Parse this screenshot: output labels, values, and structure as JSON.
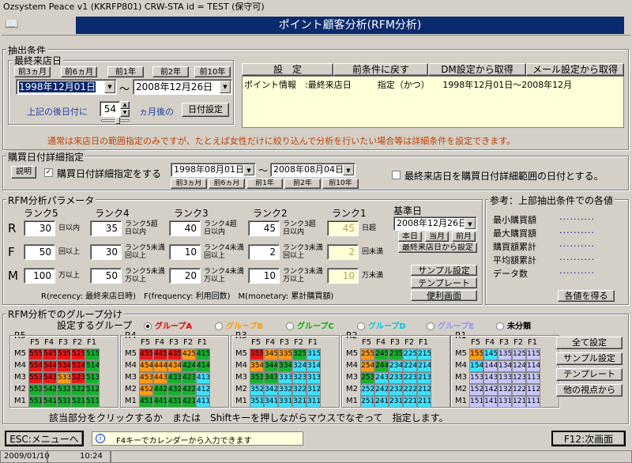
{
  "window_title": "Ozsystem Peace v1 (KKRFP801)   CRW-STA   id = TEST   (保守可)",
  "banner_title": "ポイント顧客分析(RFM分析)",
  "extract": {
    "group_label": "抽出条件",
    "last_visit_label": "最終来店日",
    "range_buttons": [
      "前3ヵ月",
      "前6ヵ月",
      "前1年",
      "前2年",
      "前10年"
    ],
    "date_from": "1998年12月01日",
    "date_to": "2008年12月26日",
    "tilde": "～",
    "after_label": "上記の後日付に",
    "months_value": "54",
    "months_suffix": "ヵ月後の",
    "set_date_button": "日付設定",
    "tabs": [
      "設　定",
      "前条件に戻す",
      "DM設定から取得",
      "メール設定から取得"
    ],
    "condition_text": "ポイント情報　:最終来店日　　　指定（かつ）　　1998年12月01日～2008年12月",
    "note": "通常は来店日の範囲指定のみですが、たとえば女性だけに絞り込んで分析を行いたい場合等は詳細条件を設定できます。"
  },
  "purchase": {
    "group_label": "購買日付詳細指定",
    "explain_button": "説明",
    "checkbox_label": "購買日付詳細指定をする",
    "checkbox_checked": "✓",
    "date_from": "1998年08月01日",
    "date_to": "2008年08月04日",
    "tilde": "～",
    "range_buttons": [
      "前3ヵ月",
      "前6ヵ月",
      "前1年",
      "前2年",
      "前10年"
    ],
    "last_visit_checkbox_label": "最終来店日を購買日付詳細範囲の日付とする。"
  },
  "rfm": {
    "group_label": "RFM分析パラメータ",
    "rank_headers": [
      "ランク5",
      "ランク4",
      "ランク3",
      "ランク2",
      "ランク1"
    ],
    "row_letters": [
      "R",
      "F",
      "M"
    ],
    "r_values": [
      "30",
      "35",
      "40",
      "45",
      "45"
    ],
    "f_values": [
      "50",
      "30",
      "10",
      "2",
      "2"
    ],
    "m_values": [
      "100",
      "50",
      "20",
      "10",
      "10"
    ],
    "r_units": [
      "日以内",
      "ランク5超\n日以内",
      "ランク4超\n日以内",
      "ランク3超\n日以内",
      "日超"
    ],
    "f_units": [
      "回以上",
      "ランク5未満\n回以上",
      "ランク4未満\n回以上",
      "ランク3未満\n回以上",
      "回未満"
    ],
    "m_units": [
      "万以上",
      "ランク5未満\n万以上",
      "ランク4未満\n万以上",
      "ランク3未満\n万以上",
      "万未満"
    ],
    "base_date_label": "基準日",
    "base_date": "2008年12月26日",
    "base_buttons": [
      "本日",
      "当月",
      "前月"
    ],
    "from_last_visit_button": "最終来店日から設定",
    "sample_button": "サンプル設定",
    "template_button": "テンプレート",
    "convenient_button": "便利画面",
    "legend": "R(recency: 最終来店日時)　F(frequency: 利用回数)　M(monetary: 累計購買額)"
  },
  "reference": {
    "group_label": "参考：上部抽出条件での各値",
    "items": [
      "最小購買額",
      "最大購買額",
      "購買額累計",
      "平均額累計",
      "データ数"
    ],
    "dots": "..........",
    "get_button": "各値を得る"
  },
  "groups": {
    "group_label": "RFM分析でのグループ分け",
    "set_label": "設定するグループ",
    "options": [
      {
        "label": "グループA",
        "color": "#e00000",
        "on": true
      },
      {
        "label": "グループB",
        "color": "#ff9900",
        "on": false
      },
      {
        "label": "グループC",
        "color": "#00b000",
        "on": false
      },
      {
        "label": "グループD",
        "color": "#00c8e0",
        "on": false
      },
      {
        "label": "グループE",
        "color": "#9090ff",
        "on": false
      },
      {
        "label": "未分類",
        "color": "#000000",
        "on": false
      }
    ],
    "f_headers": [
      "F5",
      "F4",
      "F3",
      "F2",
      "F1"
    ],
    "m_labels": [
      "M5",
      "M4",
      "M3",
      "M2",
      "M1"
    ],
    "blocks": [
      {
        "title": "R5",
        "rows": [
          [
            "555",
            "545",
            "535",
            "525",
            "515"
          ],
          [
            "554",
            "544",
            "534",
            "524",
            "514"
          ],
          [
            "553",
            "543",
            "533",
            "523",
            "513"
          ],
          [
            "552",
            "542",
            "532",
            "522",
            "512"
          ],
          [
            "551",
            "541",
            "531",
            "521",
            "511"
          ]
        ],
        "colors": [
          [
            "r",
            "r",
            "r",
            "r",
            "g"
          ],
          [
            "r",
            "r",
            "r",
            "r",
            "g"
          ],
          [
            "r",
            "r",
            "o",
            "r",
            "g"
          ],
          [
            "g",
            "g",
            "g",
            "g",
            "g"
          ],
          [
            "g",
            "g",
            "g",
            "g",
            "g"
          ]
        ]
      },
      {
        "title": "R4",
        "rows": [
          [
            "455",
            "445",
            "435",
            "425",
            "415"
          ],
          [
            "454",
            "444",
            "434",
            "424",
            "414"
          ],
          [
            "453",
            "443",
            "433",
            "423",
            "413"
          ],
          [
            "452",
            "442",
            "432",
            "422",
            "412"
          ],
          [
            "451",
            "441",
            "431",
            "421",
            "411"
          ]
        ],
        "colors": [
          [
            "r",
            "r",
            "r",
            "o",
            "g"
          ],
          [
            "o",
            "o",
            "o",
            "g",
            "g"
          ],
          [
            "o",
            "o",
            "g",
            "g",
            "c"
          ],
          [
            "o",
            "g",
            "g",
            "g",
            "c"
          ],
          [
            "g",
            "g",
            "g",
            "g",
            "c"
          ]
        ]
      },
      {
        "title": "R3",
        "rows": [
          [
            "355",
            "345",
            "335",
            "325",
            "315"
          ],
          [
            "354",
            "344",
            "334",
            "324",
            "314"
          ],
          [
            "353",
            "343",
            "333",
            "323",
            "313"
          ],
          [
            "352",
            "342",
            "332",
            "322",
            "312"
          ],
          [
            "351",
            "341",
            "331",
            "321",
            "311"
          ]
        ],
        "colors": [
          [
            "r",
            "o",
            "o",
            "g",
            "c"
          ],
          [
            "o",
            "g",
            "g",
            "c",
            "c"
          ],
          [
            "g",
            "g",
            "c",
            "c",
            "c"
          ],
          [
            "c",
            "c",
            "c",
            "c",
            "c"
          ],
          [
            "c",
            "c",
            "c",
            "c",
            "c"
          ]
        ]
      },
      {
        "title": "R2",
        "rows": [
          [
            "255",
            "245",
            "235",
            "225",
            "215"
          ],
          [
            "254",
            "244",
            "234",
            "224",
            "214"
          ],
          [
            "253",
            "243",
            "233",
            "223",
            "213"
          ],
          [
            "252",
            "242",
            "232",
            "222",
            "212"
          ],
          [
            "251",
            "241",
            "231",
            "221",
            "211"
          ]
        ],
        "colors": [
          [
            "o",
            "g",
            "g",
            "c",
            "c"
          ],
          [
            "o",
            "g",
            "c",
            "c",
            "c"
          ],
          [
            "g",
            "c",
            "c",
            "c",
            "c"
          ],
          [
            "c",
            "c",
            "c",
            "c",
            "c"
          ],
          [
            "c",
            "c",
            "c",
            "c",
            "c"
          ]
        ]
      },
      {
        "title": "R1",
        "rows": [
          [
            "155",
            "145",
            "135",
            "125",
            "115"
          ],
          [
            "154",
            "144",
            "134",
            "124",
            "114"
          ],
          [
            "153",
            "143",
            "133",
            "123",
            "113"
          ],
          [
            "152",
            "142",
            "132",
            "122",
            "112"
          ],
          [
            "151",
            "141",
            "131",
            "121",
            "111"
          ]
        ],
        "colors": [
          [
            "o",
            "c",
            "p",
            "p",
            "p"
          ],
          [
            "c",
            "p",
            "p",
            "p",
            "p"
          ],
          [
            "p",
            "p",
            "p",
            "p",
            "p"
          ],
          [
            "p",
            "p",
            "p",
            "p",
            "p"
          ],
          [
            "p",
            "p",
            "p",
            "p",
            "p"
          ]
        ]
      }
    ],
    "side_buttons": [
      "全て設定",
      "サンプル設定",
      "テンプレート",
      "他の視点から"
    ],
    "instruction": "該当部分をクリックするか　または　Shiftキーを押しながらマウスでなぞって　指定します。"
  },
  "footer": {
    "esc_button": "ESC:メニューへ",
    "hint": "F4キーでカレンダーから入力できます",
    "f12_button": "F12:次画面",
    "date": "2009/01/10",
    "time": "10:24"
  },
  "cell_colors": {
    "r": "#e81818",
    "o": "#ff9a1a",
    "g": "#18b030",
    "c": "#40e0ff",
    "p": "#c8c8ff"
  }
}
